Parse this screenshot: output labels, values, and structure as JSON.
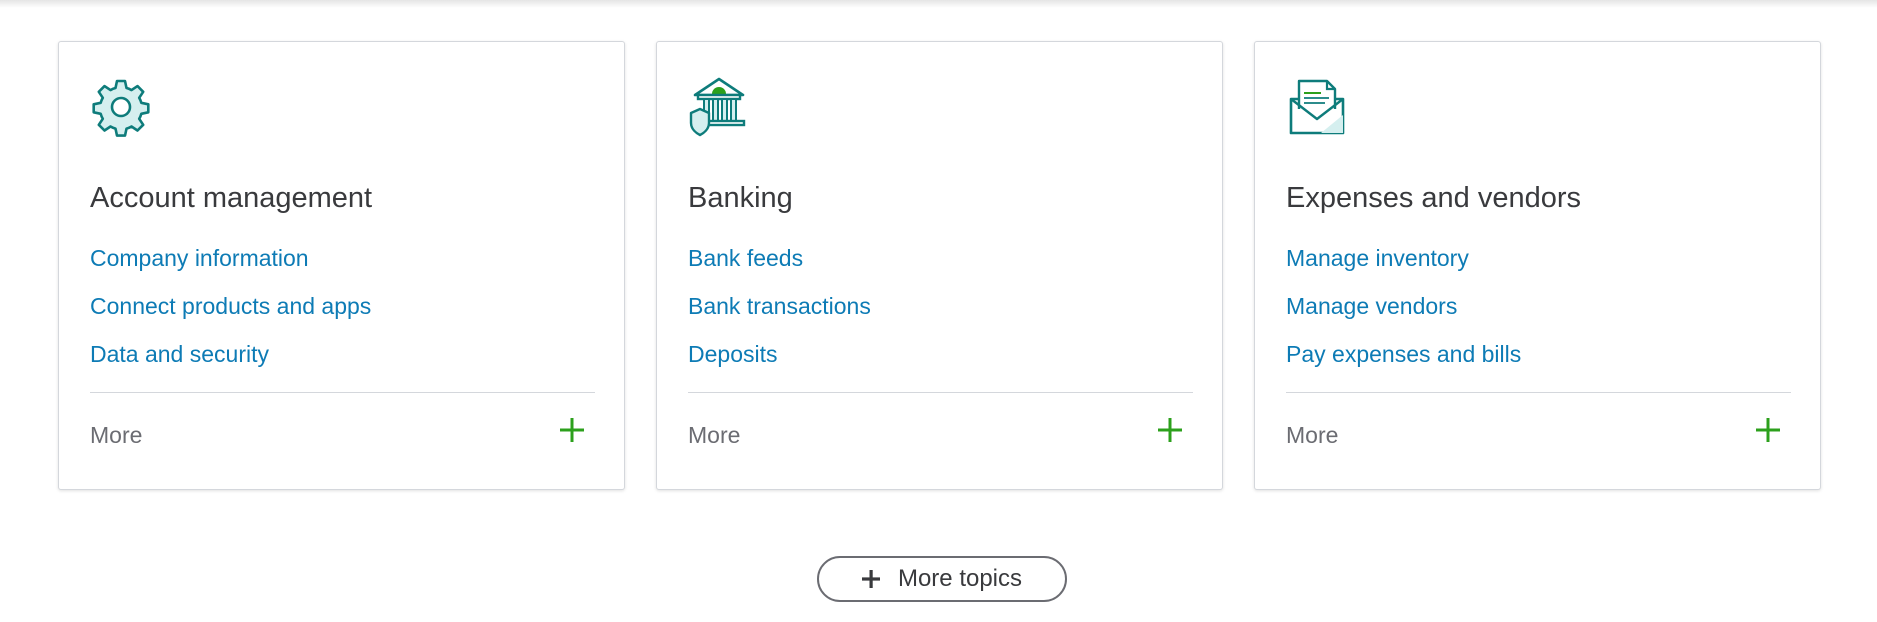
{
  "cards": [
    {
      "icon": "gear-icon",
      "title": "Account management",
      "links": [
        "Company information",
        "Connect products and apps",
        "Data and security"
      ],
      "more_label": "More"
    },
    {
      "icon": "bank-shield-icon",
      "title": "Banking",
      "links": [
        "Bank feeds",
        "Bank transactions",
        "Deposits"
      ],
      "more_label": "More"
    },
    {
      "icon": "envelope-document-icon",
      "title": "Expenses and vendors",
      "links": [
        "Manage inventory",
        "Manage vendors",
        "Pay expenses and bills"
      ],
      "more_label": "More"
    }
  ],
  "more_topics_button": {
    "label": "More topics"
  },
  "colors": {
    "link": "#0d7bb5",
    "title": "#393a3d",
    "icon_teal": "#0e7c7b",
    "icon_fill": "#d5efef",
    "plus_green": "#2ca01c",
    "muted": "#6b6c72"
  }
}
